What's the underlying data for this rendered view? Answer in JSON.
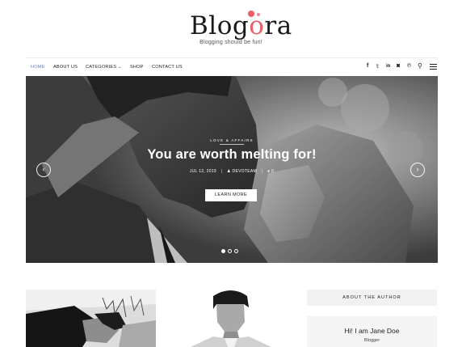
{
  "brand": {
    "logo_before": "Blog",
    "logo_o": "o",
    "logo_after": "ra",
    "tagline": "Blogging should be fun!",
    "accent_color": "#ec5d68"
  },
  "nav": {
    "items": [
      {
        "label": "HOME",
        "active": true
      },
      {
        "label": "ABOUT US",
        "active": false
      },
      {
        "label": "CATEGORIES",
        "active": false,
        "has_dropdown": true
      },
      {
        "label": "SHOP",
        "active": false
      },
      {
        "label": "CONTACT US",
        "active": false
      }
    ],
    "active_color": "#6b79c4",
    "social_icons": [
      "facebook-icon",
      "twitter-icon",
      "linkedin-icon",
      "instagram-icon",
      "pinterest-icon"
    ],
    "social_glyphs": [
      "f",
      "𝕥",
      "in",
      "◙",
      "℗"
    ],
    "search_glyph": "⚲"
  },
  "hero": {
    "category": "LOVE & AFFAIRS",
    "title": "You are worth melting for!",
    "date": "JUL 12, 2019",
    "author": "DEVOTEAM",
    "comments": "0",
    "button_label": "LEARN MORE",
    "prev_arrow": "‹",
    "next_arrow": "›",
    "slide_count": 3,
    "active_slide": 1
  },
  "sidebar": {
    "widget_title": "ABOUT THE AUTHOR",
    "author_greeting": "Hi! I am Jane Doe",
    "author_role": "Blogger"
  }
}
